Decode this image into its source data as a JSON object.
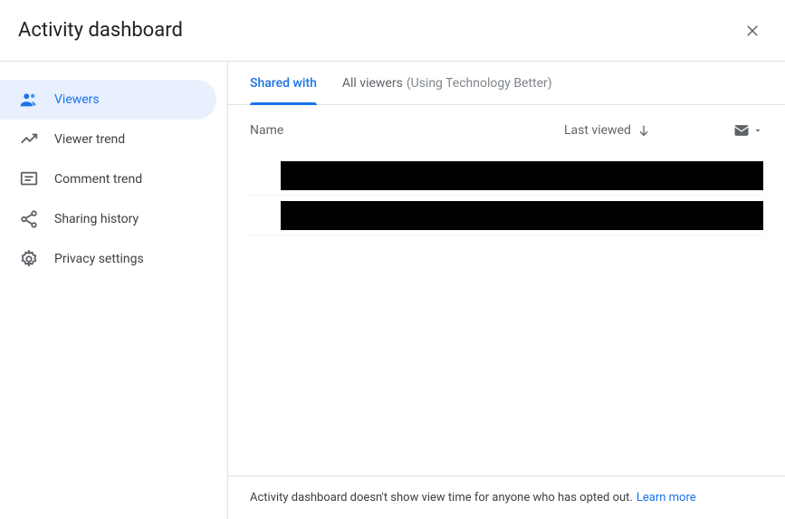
{
  "header": {
    "title": "Activity dashboard"
  },
  "sidebar": {
    "items": [
      {
        "label": "Viewers"
      },
      {
        "label": "Viewer trend"
      },
      {
        "label": "Comment trend"
      },
      {
        "label": "Sharing history"
      },
      {
        "label": "Privacy settings"
      }
    ]
  },
  "tabs": {
    "shared_with": "Shared with",
    "all_viewers": "All viewers",
    "all_viewers_suffix": "(Using Technology Better)"
  },
  "columns": {
    "name": "Name",
    "last_viewed": "Last viewed"
  },
  "footer": {
    "text": "Activity dashboard doesn't show view time for anyone who has opted out.",
    "link": "Learn more"
  }
}
